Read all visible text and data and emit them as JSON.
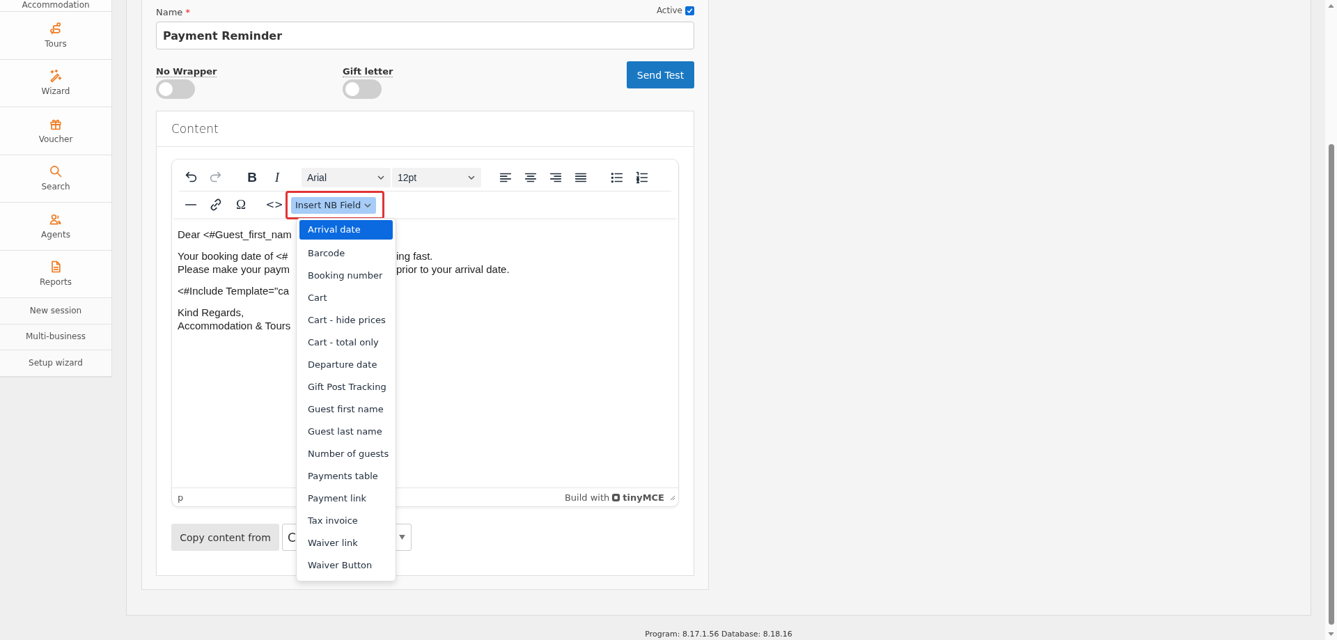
{
  "sidebar": {
    "items": [
      {
        "kind": "top",
        "label": "Accommodation"
      },
      {
        "kind": "large",
        "label": "Tours"
      },
      {
        "kind": "large",
        "label": "Wizard"
      },
      {
        "kind": "large",
        "label": "Voucher"
      },
      {
        "kind": "large",
        "label": "Search"
      },
      {
        "kind": "large",
        "label": "Agents"
      },
      {
        "kind": "large",
        "label": "Reports"
      },
      {
        "kind": "small",
        "label": "New session"
      },
      {
        "kind": "small",
        "label": "Multi-business"
      },
      {
        "kind": "small",
        "label": "Setup wizard"
      }
    ]
  },
  "form": {
    "name_label": "Name",
    "required_mark": "*",
    "active": {
      "label": "Active",
      "checked": true
    },
    "name_value": "Payment Reminder",
    "toggles": [
      {
        "label": "No Wrapper",
        "on": false
      },
      {
        "label": "Gift letter",
        "on": false
      }
    ],
    "send_button": "Send Test"
  },
  "content": {
    "title": "Content",
    "toolbar": {
      "undo_disabled": false,
      "redo_disabled": true,
      "bold": "B",
      "italic": "I",
      "font": "Arial",
      "size": "12pt",
      "special_char": "Ω",
      "code": "<>",
      "nb_field": {
        "label": "Insert NB Field",
        "highlighted": true
      }
    },
    "body": [
      [
        {
          "left": "Dear <#Guest_first_nam"
        }
      ],
      [
        {
          "left": "Your booking date of <#",
          "right": "ing fast."
        },
        {
          "left": "Please make your paym",
          "right": "prior to your arrival date."
        }
      ],
      [
        {
          "left": "<#Include Template=\"ca"
        }
      ],
      [
        {
          "left": "Kind Regards,"
        },
        {
          "left": "Accommodation & Tours"
        }
      ]
    ],
    "status_path": "p",
    "branding": "Build with",
    "brand": "tinyMCE",
    "dropdown": [
      {
        "label": "Arrival date",
        "selected": true
      },
      {
        "label": "Barcode",
        "selected": false
      },
      {
        "label": "Booking number",
        "selected": false
      },
      {
        "label": "Cart",
        "selected": false
      },
      {
        "label": "Cart - hide prices",
        "selected": false
      },
      {
        "label": "Cart - total only",
        "selected": false
      },
      {
        "label": "Departure date",
        "selected": false
      },
      {
        "label": "Gift Post Tracking",
        "selected": false
      },
      {
        "label": "Guest first name",
        "selected": false
      },
      {
        "label": "Guest last name",
        "selected": false
      },
      {
        "label": "Number of guests",
        "selected": false
      },
      {
        "label": "Payments table",
        "selected": false
      },
      {
        "label": "Payment link",
        "selected": false
      },
      {
        "label": "Tax invoice",
        "selected": false
      },
      {
        "label": "Waiver link",
        "selected": false
      },
      {
        "label": "Waiver Button",
        "selected": false
      }
    ],
    "copy_button": "Copy content from",
    "copy_select_value": "C"
  },
  "footer": "Program: 8.17.1.56 Database: 8.18.16"
}
